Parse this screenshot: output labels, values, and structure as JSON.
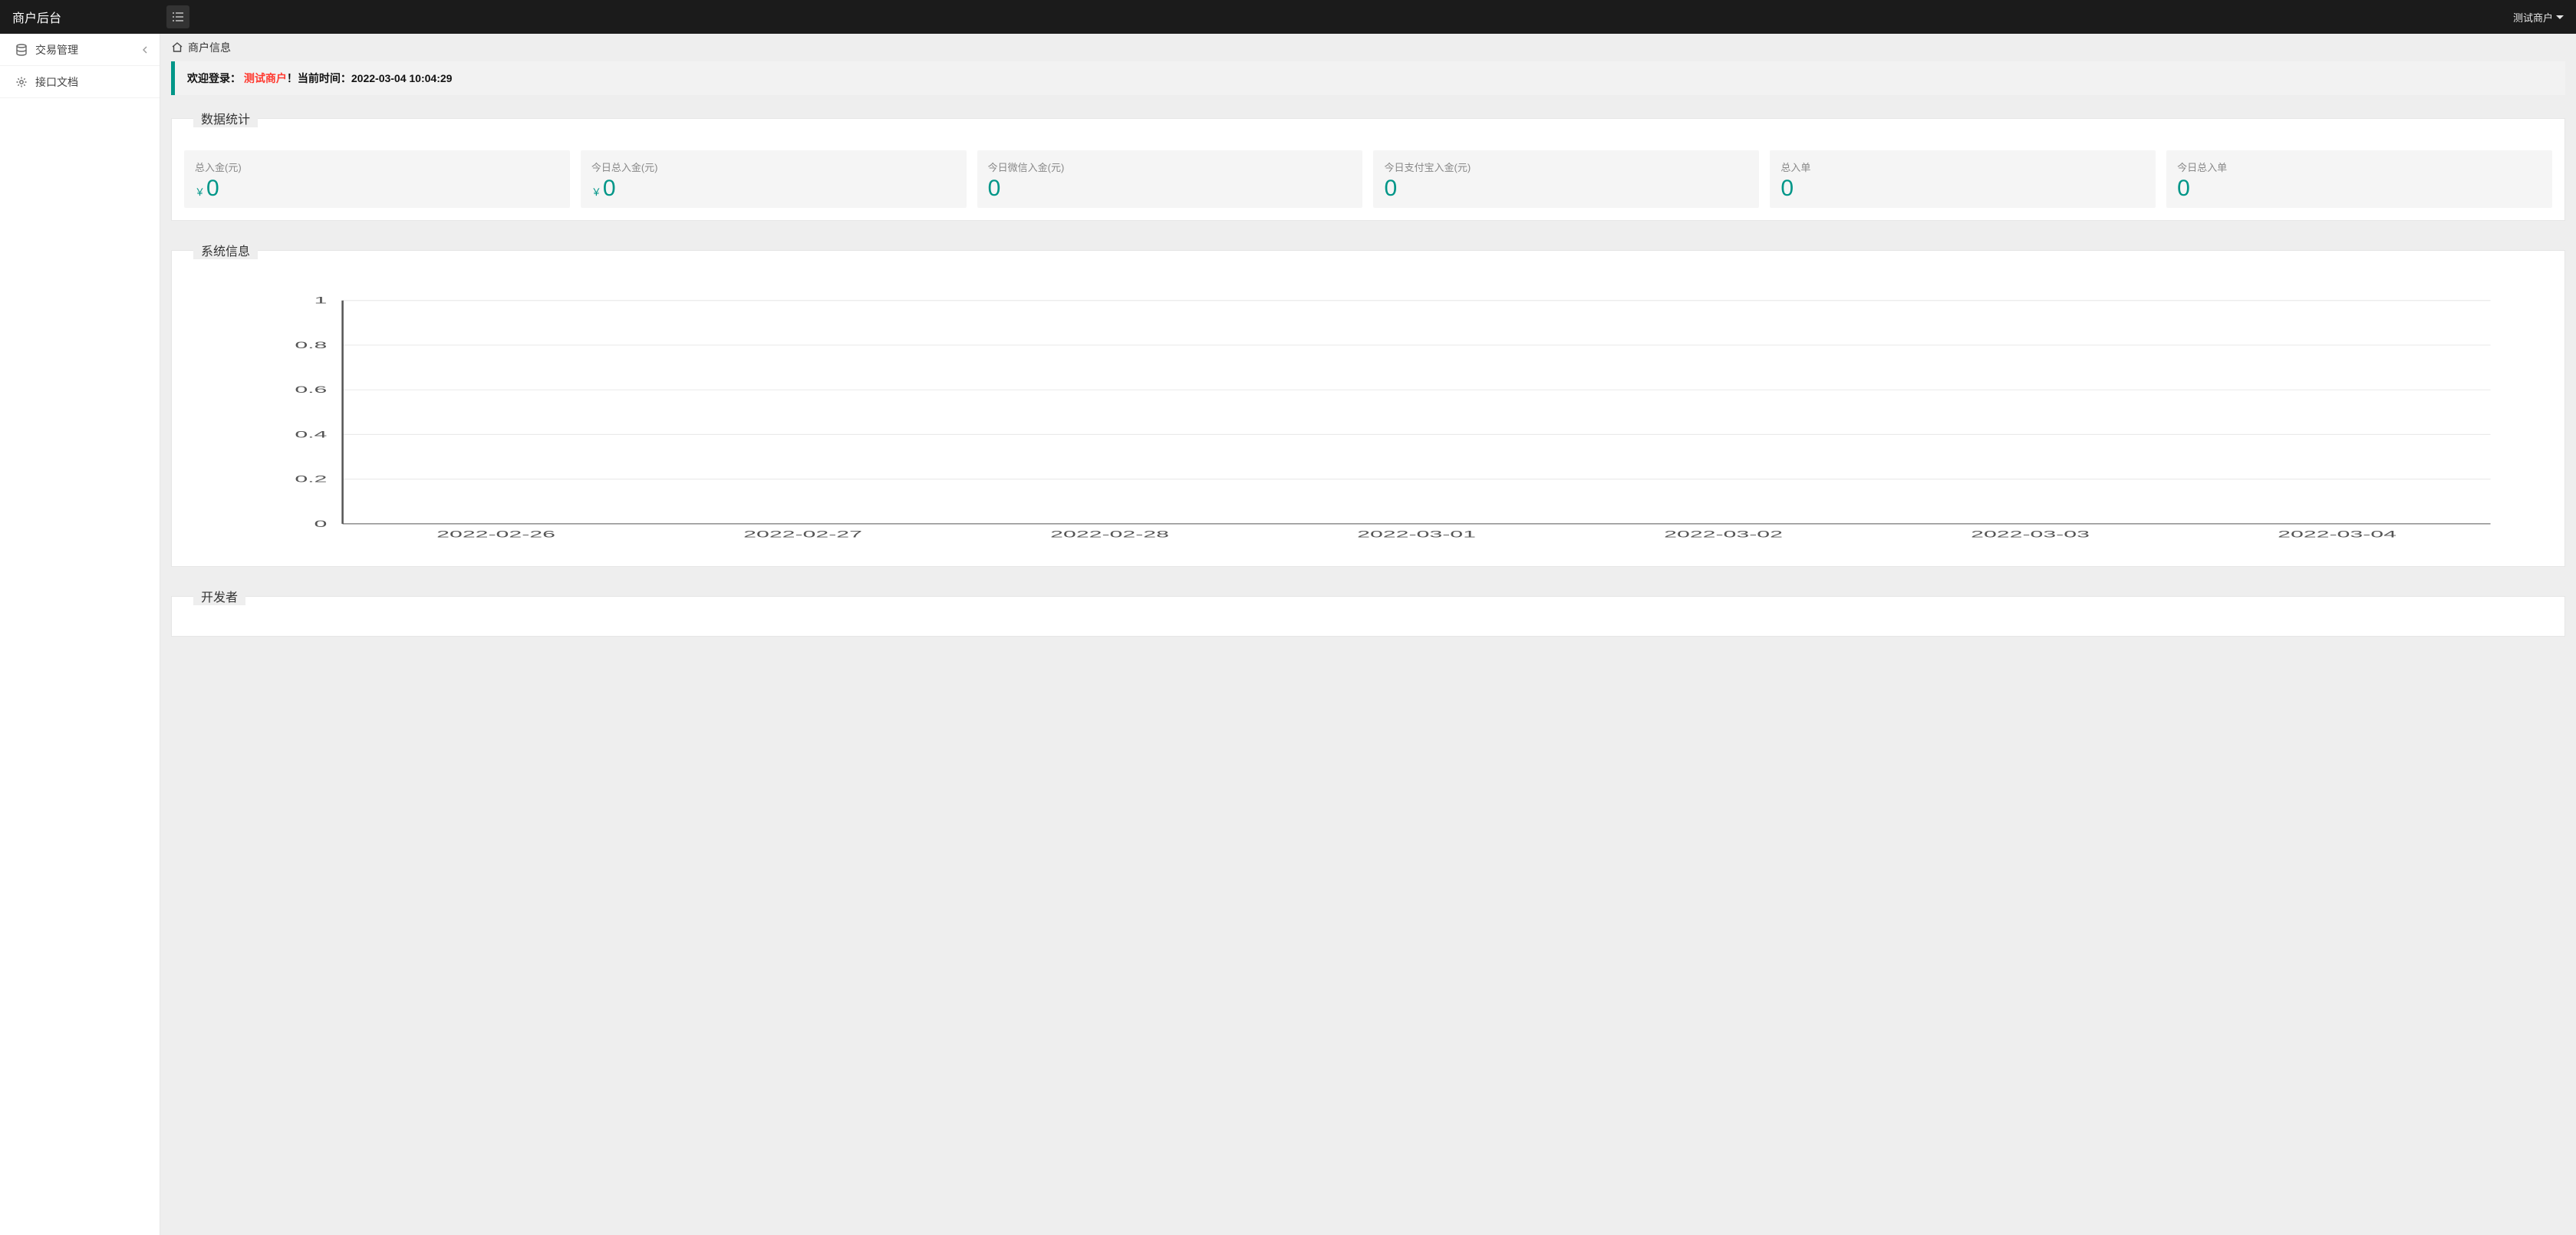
{
  "header": {
    "logo": "商户后台",
    "user_name": "测试商户"
  },
  "sidebar": {
    "items": [
      {
        "label": "交易管理",
        "icon": "database",
        "expandable": true
      },
      {
        "label": "接口文档",
        "icon": "gear",
        "expandable": false
      }
    ]
  },
  "breadcrumb": {
    "title": "商户信息"
  },
  "welcome": {
    "prefix": "欢迎登录：",
    "user": "测试商户",
    "suffix": "！当前时间：",
    "time": "2022-03-04 10:04:29"
  },
  "sections": {
    "stats_title": "数据统计",
    "system_title": "系统信息",
    "dev_title": "开发者"
  },
  "stats": [
    {
      "label": "总入金(元)",
      "prefix": "￥",
      "value": "0"
    },
    {
      "label": "今日总入金(元)",
      "prefix": "￥",
      "value": "0"
    },
    {
      "label": "今日微信入金(元)",
      "prefix": "",
      "value": "0"
    },
    {
      "label": "今日支付宝入金(元)",
      "prefix": "",
      "value": "0"
    },
    {
      "label": "总入单",
      "prefix": "",
      "value": "0"
    },
    {
      "label": "今日总入单",
      "prefix": "",
      "value": "0"
    }
  ],
  "chart_data": {
    "type": "line",
    "categories": [
      "2022-02-26",
      "2022-02-27",
      "2022-02-28",
      "2022-03-01",
      "2022-03-02",
      "2022-03-03",
      "2022-03-04"
    ],
    "values": [
      0,
      0,
      0,
      0,
      0,
      0,
      0
    ],
    "ylim": [
      0,
      1
    ],
    "yticks": [
      0,
      0.2,
      0.4,
      0.6,
      0.8,
      1
    ],
    "xlabel": "",
    "ylabel": "",
    "title": ""
  }
}
